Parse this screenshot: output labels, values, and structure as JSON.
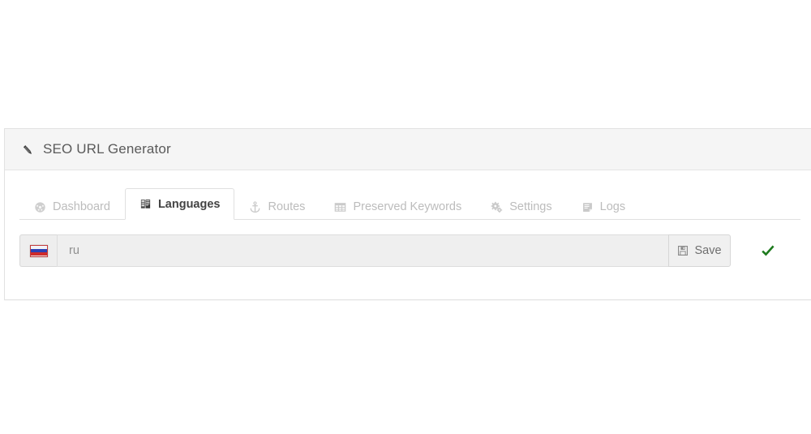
{
  "panel": {
    "title": "SEO URL Generator",
    "title_icon": "pencil-icon"
  },
  "tabs": [
    {
      "label": "Dashboard",
      "icon": "dashboard-gauge-icon",
      "active": false
    },
    {
      "label": "Languages",
      "icon": "flag-book-icon",
      "active": true
    },
    {
      "label": "Routes",
      "icon": "anchor-icon",
      "active": false
    },
    {
      "label": "Preserved Keywords",
      "icon": "table-grid-icon",
      "active": false
    },
    {
      "label": "Settings",
      "icon": "cogs-icon",
      "active": false
    },
    {
      "label": "Logs",
      "icon": "note-file-icon",
      "active": false
    }
  ],
  "language_row": {
    "flag_icon": "russia-flag-icon",
    "flag_title": "ru",
    "input_value": "ru",
    "input_placeholder": "ru",
    "save_label": "Save",
    "save_icon": "floppy-save-icon",
    "status_icon": "green-check-icon"
  },
  "colors": {
    "panel_header_bg": "#f5f5f5",
    "panel_border": "#e2e2e2",
    "tab_inactive_text": "#bcbcbc",
    "tab_active_text": "#444444",
    "input_bg": "#efefef",
    "input_text": "#8f8f8f",
    "save_bg": "#f0f0f0",
    "status_green": "#1d7a1d",
    "flag_white": "#f2f2f7",
    "flag_blue": "#2b41b5",
    "flag_red": "#cf2b2b"
  }
}
